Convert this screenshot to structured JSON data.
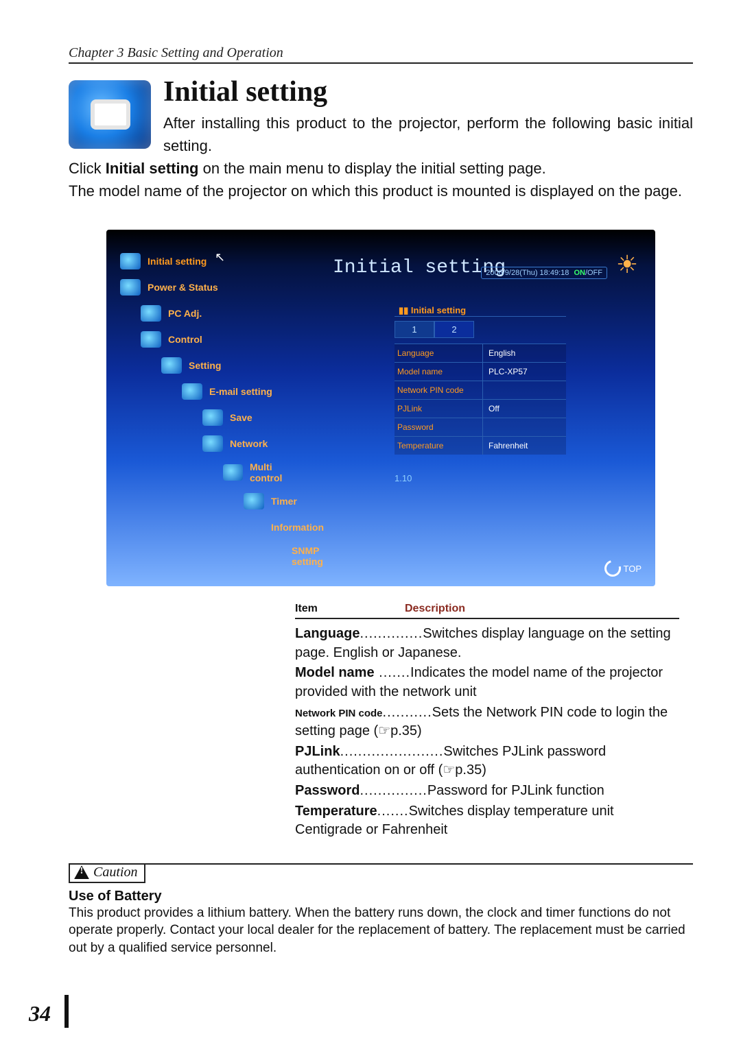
{
  "chapter": "Chapter 3 Basic Setting and Operation",
  "sectionTitle": "Initial setting",
  "intro": {
    "p1": "After installing this product to the projector, perform the following basic initial setting.",
    "p2a": "Click ",
    "p2b": "Initial setting",
    "p2c": " on the main menu to display the initial setting page.",
    "p3": "The model name of the projector on which this product is mounted is displayed on the page."
  },
  "screenshot": {
    "menu": [
      "Initial setting",
      "Power & Status",
      "PC Adj.",
      "Control",
      "Setting",
      "E-mail setting",
      "Save",
      "Network",
      "Multi control",
      "Timer",
      "Information",
      "SNMP setting"
    ],
    "panelTitle": "Initial setting",
    "dateBadge": "2006/9/28(Thu) 18:49:18",
    "dateOn": "ON",
    "dateOff": "OFF",
    "subTitle": "Initial setting",
    "tabs": [
      "1",
      "2"
    ],
    "rows": [
      {
        "k": "Language",
        "v": "English"
      },
      {
        "k": "Model name",
        "v": "PLC-XP57"
      },
      {
        "k": "Network PIN code",
        "v": ""
      },
      {
        "k": "PJLink",
        "v": "Off"
      },
      {
        "k": "Password",
        "v": ""
      },
      {
        "k": "Temperature",
        "v": "Fahrenheit"
      }
    ],
    "footLabel": "1.10",
    "topLabel": "TOP"
  },
  "tableHead": {
    "item": "Item",
    "desc": "Description"
  },
  "descRows": [
    {
      "term": "Language",
      "dots": "..............",
      "desc": "Switches display language on the setting page. English or Japanese."
    },
    {
      "term": "Model name",
      "dots": " .......",
      "desc": "Indicates the model name of the projector provided with the network unit"
    },
    {
      "term": "Network PIN code",
      "dots": "...........",
      "desc": "Sets the Network PIN code to login the setting page (☞p.35)",
      "small": true
    },
    {
      "term": "PJLink",
      "dots": ".......................",
      "desc": "Switches PJLink password authentication on or off (☞p.35)"
    },
    {
      "term": "Password",
      "dots": "...............",
      "desc": "Password for PJLink function"
    },
    {
      "term": "Temperature",
      "dots": ".......",
      "desc": "Switches display temperature unit Centigrade or Fahrenheit"
    }
  ],
  "caution": {
    "label": "Caution",
    "title": "Use of Battery",
    "body": "This product provides a lithium battery. When the battery runs down, the clock and timer functions do not operate properly. Contact your local dealer for the replacement of battery. The replacement must be carried out by a qualified service personnel."
  },
  "pageNumber": "34"
}
